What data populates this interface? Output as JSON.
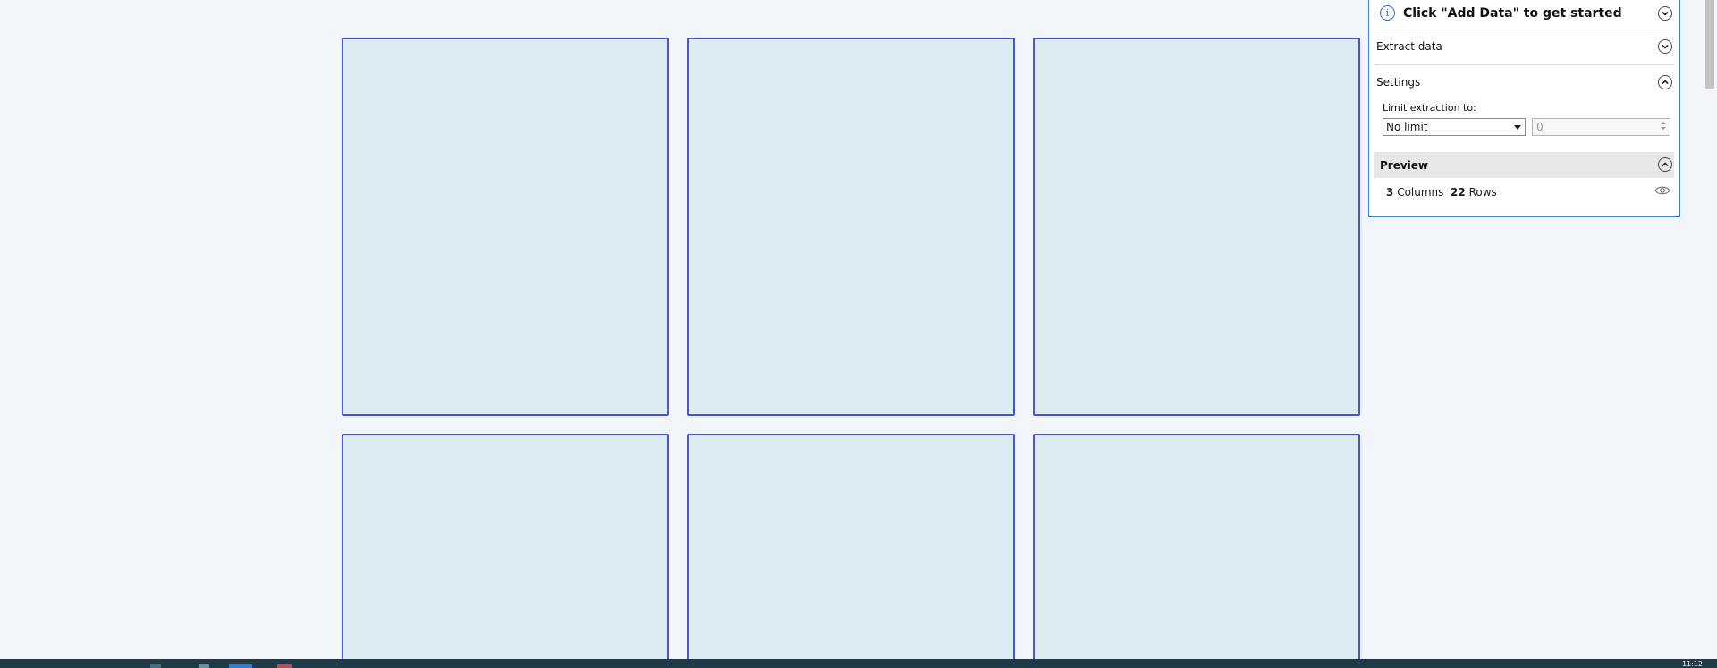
{
  "panel": {
    "info_section": {
      "title": "Click \"Add Data\" to get started"
    },
    "extract_section": {
      "title": "Extract data"
    },
    "settings_section": {
      "title": "Settings",
      "limit_label": "Limit extraction to:",
      "limit_select_value": "No limit",
      "limit_number_value": "0"
    },
    "preview_section": {
      "title": "Preview",
      "columns_count": "3",
      "columns_label": "Columns",
      "rows_count": "22",
      "rows_label": "Rows"
    }
  },
  "taskbar": {
    "clock": "11:12"
  },
  "colors": {
    "tile_fill": "#dcecf3",
    "tile_border": "#4d52d6",
    "panel_border": "#3d7fd6",
    "info_blue": "#2a6fd0"
  }
}
